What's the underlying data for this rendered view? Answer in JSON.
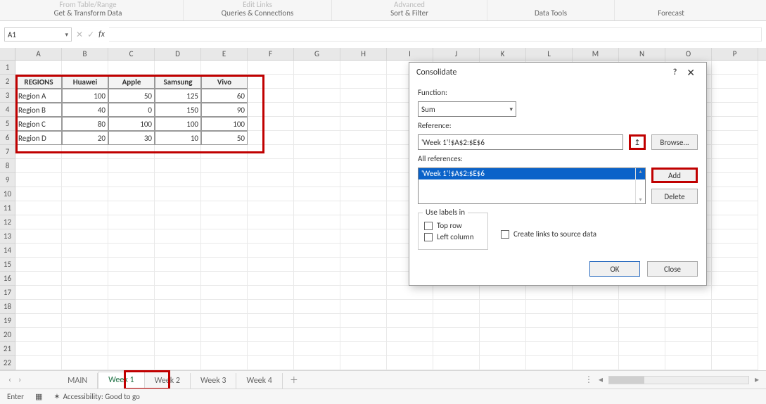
{
  "ribbon": {
    "groups": [
      {
        "top": "From Table/Range",
        "label": "Get & Transform Data"
      },
      {
        "top": "Edit Links",
        "label": "Queries & Connections"
      },
      {
        "top": "Advanced",
        "label": "Sort & Filter"
      },
      {
        "top": "",
        "label": "Data Tools"
      },
      {
        "top": "",
        "label": "Forecast"
      }
    ]
  },
  "namebox": "A1",
  "table": {
    "headers": [
      "REGIONS",
      "Huawei",
      "Apple",
      "Samsung",
      "Vivo"
    ],
    "rows": [
      {
        "region": "Region A",
        "vals": [
          100,
          50,
          125,
          60
        ]
      },
      {
        "region": "Region B",
        "vals": [
          40,
          0,
          150,
          90
        ]
      },
      {
        "region": "Region C",
        "vals": [
          80,
          100,
          100,
          100
        ]
      },
      {
        "region": "Region D",
        "vals": [
          20,
          30,
          10,
          50
        ]
      }
    ]
  },
  "dialog": {
    "title": "Consolidate",
    "function_label": "Function:",
    "function_value": "Sum",
    "reference_label": "Reference:",
    "reference_value": "'Week 1'!$A$2:$E$6",
    "browse": "Browse...",
    "allrefs_label": "All references:",
    "allrefs_item": "'Week 1'!$A$2:$E$6",
    "add": "Add",
    "delete": "Delete",
    "uselabels_legend": "Use labels in",
    "toprow": "Top row",
    "leftcol": "Left column",
    "createlinks": "Create links to source data",
    "ok": "OK",
    "close": "Close"
  },
  "sheets": {
    "tabs": [
      "MAIN",
      "Week 1",
      "Week 2",
      "Week 3",
      "Week 4"
    ],
    "active": "Week 1"
  },
  "status": {
    "mode": "Enter",
    "acc": "Accessibility: Good to go"
  },
  "cols": [
    "A",
    "B",
    "C",
    "D",
    "E",
    "F",
    "G",
    "H",
    "I",
    "J",
    "K",
    "L",
    "M",
    "N",
    "O",
    "P"
  ],
  "rows_n": 22
}
